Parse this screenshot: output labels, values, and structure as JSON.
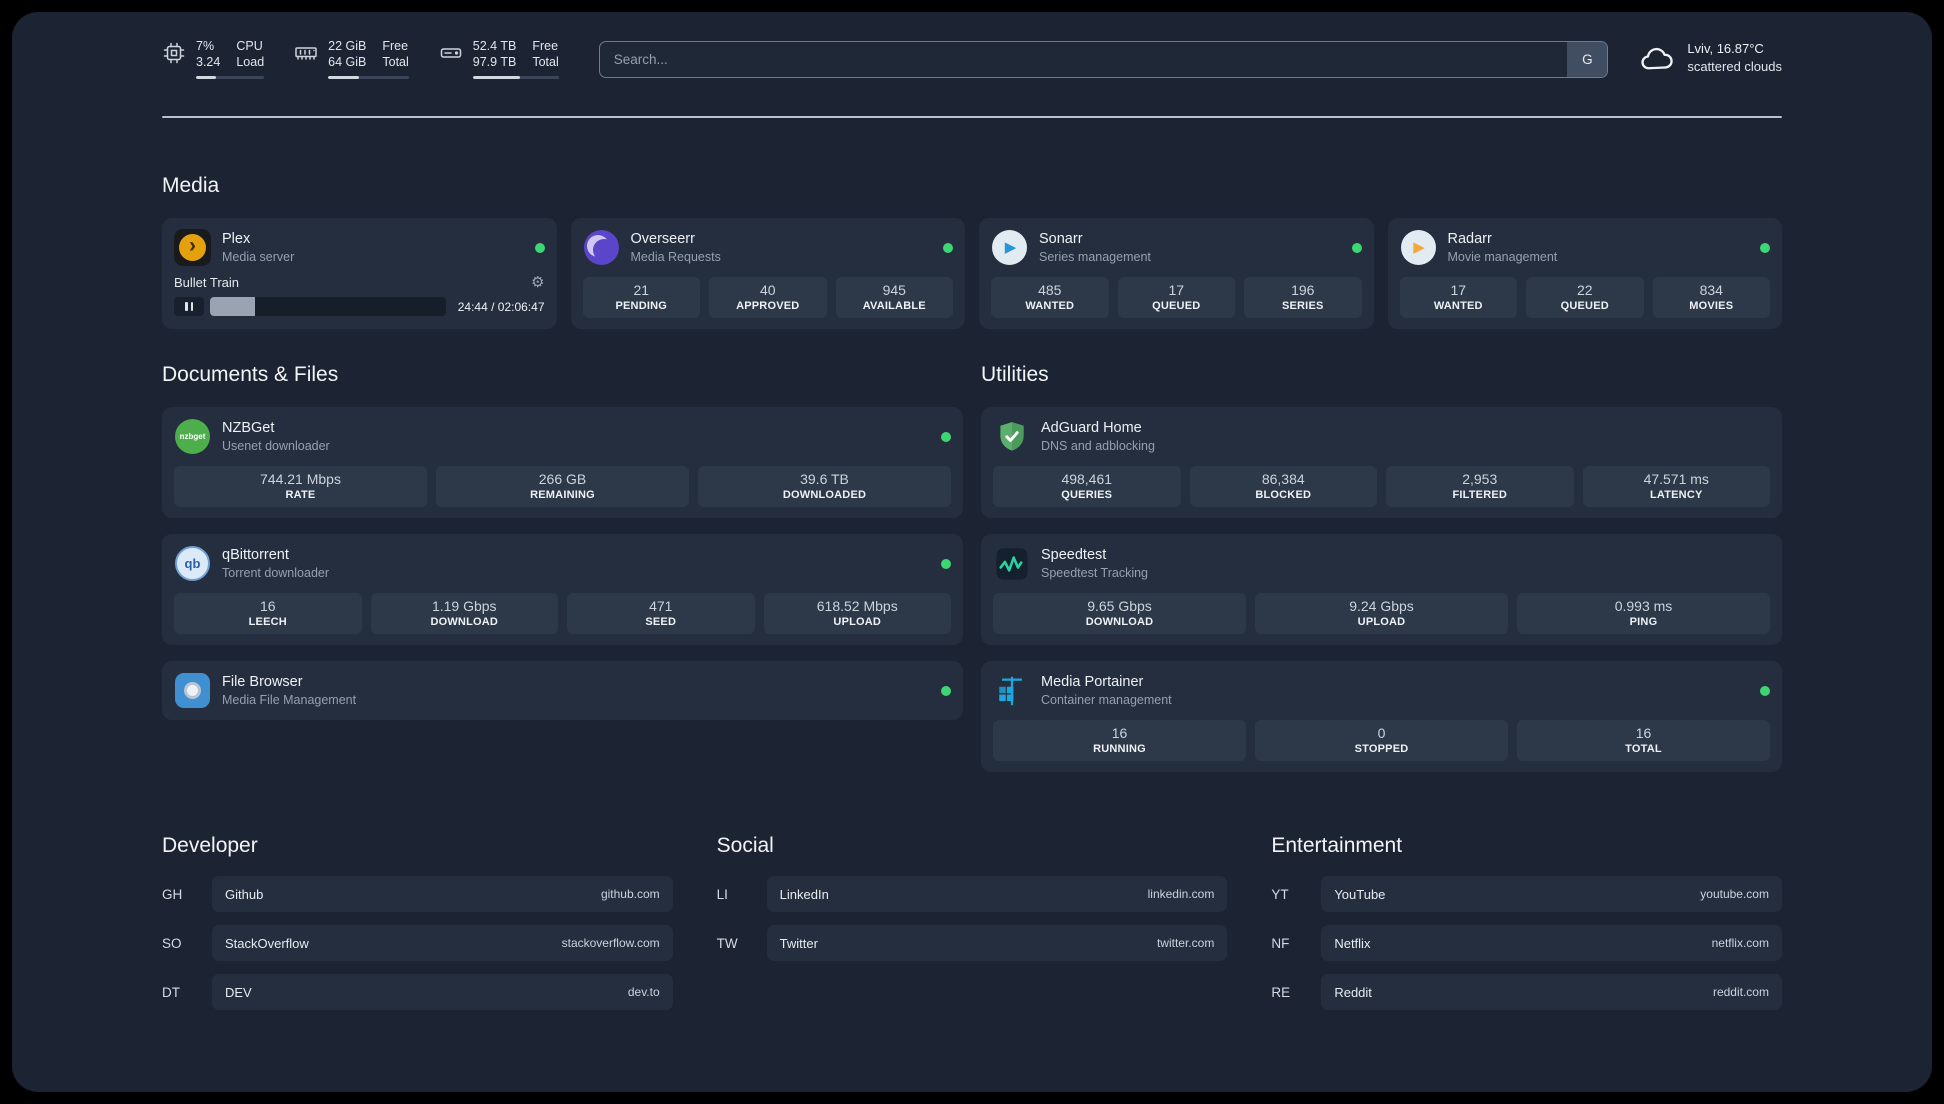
{
  "colors": {
    "status_green": "#3ed672",
    "plex_amber": "#e5a00d",
    "overseerr_purple": "#5b46c9",
    "sonarr_blue": "#2794d6",
    "radarr_amber": "#f2a93b",
    "nzbget_green": "#4fae4c",
    "qbittorrent_blue": "#2a5fae",
    "filebrowser_blue": "#3f8fd1",
    "adguard_green": "#5cae6d",
    "speedtest_green": "#2bd3a2",
    "portainer_blue": "#1ea7de",
    "panel_bg": "#1c2433",
    "card_bg": "#242e3e"
  },
  "icons": {
    "gear": "⚙",
    "plex_chevron": "›",
    "play": "▶"
  },
  "header": {
    "cpu": {
      "value_top": "7%",
      "value_bottom": "3.24",
      "label_top": "CPU",
      "label_bottom": "Load",
      "bar": "30%"
    },
    "memory": {
      "value_top": "22 GiB",
      "value_bottom": "64 GiB",
      "label_top": "Free",
      "label_bottom": "Total",
      "bar": "38%"
    },
    "disk": {
      "value_top": "52.4 TB",
      "value_bottom": "97.9 TB",
      "label_top": "Free",
      "label_bottom": "Total",
      "bar": "55%"
    },
    "search": {
      "placeholder": "Search...",
      "button_label": "G"
    },
    "weather": {
      "location": "Lviv, 16.87°C",
      "condition": "scattered clouds"
    }
  },
  "media": {
    "title": "Media",
    "plex": {
      "name": "Plex",
      "subtitle": "Media server",
      "now_playing": "Bullet Train",
      "time": "24:44 / 02:06:47",
      "progress": "19%"
    },
    "overseerr": {
      "name": "Overseerr",
      "subtitle": "Media Requests",
      "stats": [
        {
          "value": "21",
          "label": "PENDING"
        },
        {
          "value": "40",
          "label": "APPROVED"
        },
        {
          "value": "945",
          "label": "AVAILABLE"
        }
      ]
    },
    "sonarr": {
      "name": "Sonarr",
      "subtitle": "Series management",
      "stats": [
        {
          "value": "485",
          "label": "WANTED"
        },
        {
          "value": "17",
          "label": "QUEUED"
        },
        {
          "value": "196",
          "label": "SERIES"
        }
      ]
    },
    "radarr": {
      "name": "Radarr",
      "subtitle": "Movie management",
      "stats": [
        {
          "value": "17",
          "label": "WANTED"
        },
        {
          "value": "22",
          "label": "QUEUED"
        },
        {
          "value": "834",
          "label": "MOVIES"
        }
      ]
    }
  },
  "documents": {
    "title": "Documents & Files",
    "nzbget": {
      "name": "NZBGet",
      "subtitle": "Usenet downloader",
      "icon_text": "nzbget",
      "stats": [
        {
          "value": "744.21 Mbps",
          "label": "RATE"
        },
        {
          "value": "266 GB",
          "label": "REMAINING"
        },
        {
          "value": "39.6 TB",
          "label": "DOWNLOADED"
        }
      ]
    },
    "qbittorrent": {
      "name": "qBittorrent",
      "subtitle": "Torrent downloader",
      "icon_text": "qb",
      "stats": [
        {
          "value": "16",
          "label": "LEECH"
        },
        {
          "value": "1.19 Gbps",
          "label": "DOWNLOAD"
        },
        {
          "value": "471",
          "label": "SEED"
        },
        {
          "value": "618.52 Mbps",
          "label": "UPLOAD"
        }
      ]
    },
    "filebrowser": {
      "name": "File Browser",
      "subtitle": "Media File Management"
    }
  },
  "utilities": {
    "title": "Utilities",
    "adguard": {
      "name": "AdGuard Home",
      "subtitle": "DNS and adblocking",
      "stats": [
        {
          "value": "498,461",
          "label": "QUERIES"
        },
        {
          "value": "86,384",
          "label": "BLOCKED"
        },
        {
          "value": "2,953",
          "label": "FILTERED"
        },
        {
          "value": "47.571 ms",
          "label": "LATENCY"
        }
      ]
    },
    "speedtest": {
      "name": "Speedtest",
      "subtitle": "Speedtest Tracking",
      "stats": [
        {
          "value": "9.65 Gbps",
          "label": "DOWNLOAD"
        },
        {
          "value": "9.24 Gbps",
          "label": "UPLOAD"
        },
        {
          "value": "0.993 ms",
          "label": "PING"
        }
      ]
    },
    "portainer": {
      "name": "Media Portainer",
      "subtitle": "Container management",
      "stats": [
        {
          "value": "16",
          "label": "RUNNING"
        },
        {
          "value": "0",
          "label": "STOPPED"
        },
        {
          "value": "16",
          "label": "TOTAL"
        }
      ]
    }
  },
  "bookmarks": {
    "developer": {
      "title": "Developer",
      "items": [
        {
          "abbr": "GH",
          "name": "Github",
          "url": "github.com"
        },
        {
          "abbr": "SO",
          "name": "StackOverflow",
          "url": "stackoverflow.com"
        },
        {
          "abbr": "DT",
          "name": "DEV",
          "url": "dev.to"
        }
      ]
    },
    "social": {
      "title": "Social",
      "items": [
        {
          "abbr": "LI",
          "name": "LinkedIn",
          "url": "linkedin.com"
        },
        {
          "abbr": "TW",
          "name": "Twitter",
          "url": "twitter.com"
        }
      ]
    },
    "entertainment": {
      "title": "Entertainment",
      "items": [
        {
          "abbr": "YT",
          "name": "YouTube",
          "url": "youtube.com"
        },
        {
          "abbr": "NF",
          "name": "Netflix",
          "url": "netflix.com"
        },
        {
          "abbr": "RE",
          "name": "Reddit",
          "url": "reddit.com"
        }
      ]
    }
  }
}
